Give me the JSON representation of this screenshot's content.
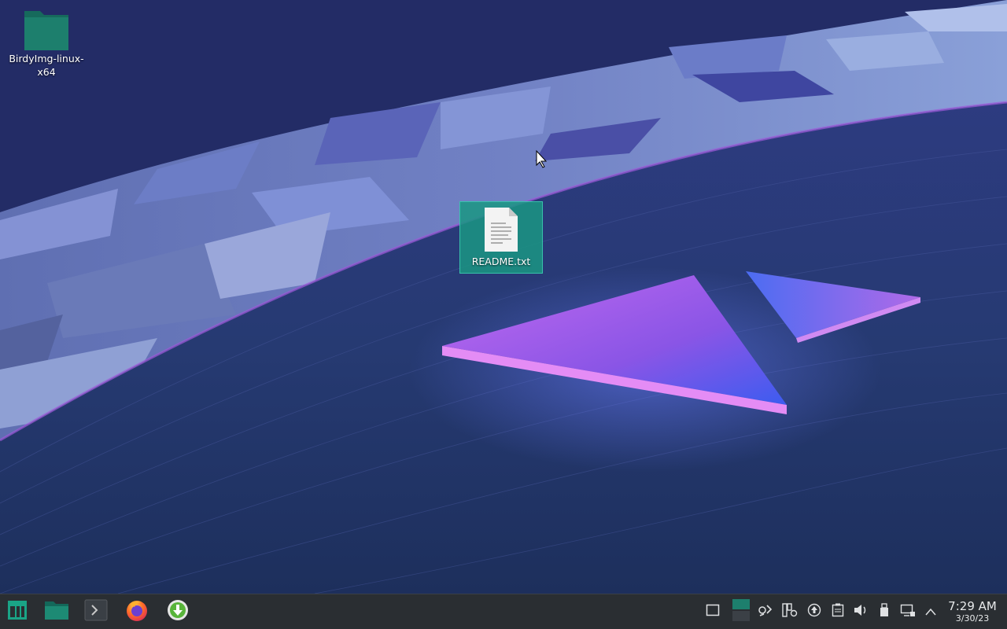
{
  "desktop": {
    "icons": [
      {
        "name": "BirdyImg-linux-x64",
        "kind": "folder-icon"
      },
      {
        "name": "README.txt",
        "kind": "text-file-icon",
        "selected": true
      }
    ]
  },
  "taskbar": {
    "launchers": [
      {
        "icon": "application-menu-icon"
      },
      {
        "icon": "file-manager-icon"
      },
      {
        "icon": "terminal-icon"
      },
      {
        "icon": "firefox-icon"
      },
      {
        "icon": "download-manager-icon"
      }
    ],
    "tray": [
      "show-desktop-icon",
      "pager-icon",
      "kde-connect-icon",
      "package-updates-icon",
      "upload-icon",
      "clipboard-icon",
      "volume-icon",
      "removable-device-icon",
      "network-icon",
      "expand-tray-icon"
    ],
    "clock": {
      "time": "7:29 AM",
      "date": "3/30/23"
    }
  },
  "colors": {
    "taskbar_bg": "#2a2e32",
    "selection": "#1a9682",
    "folder": "#1d7a6a",
    "accent_purple": "#a85be8",
    "accent_blue": "#3b6ef0"
  }
}
